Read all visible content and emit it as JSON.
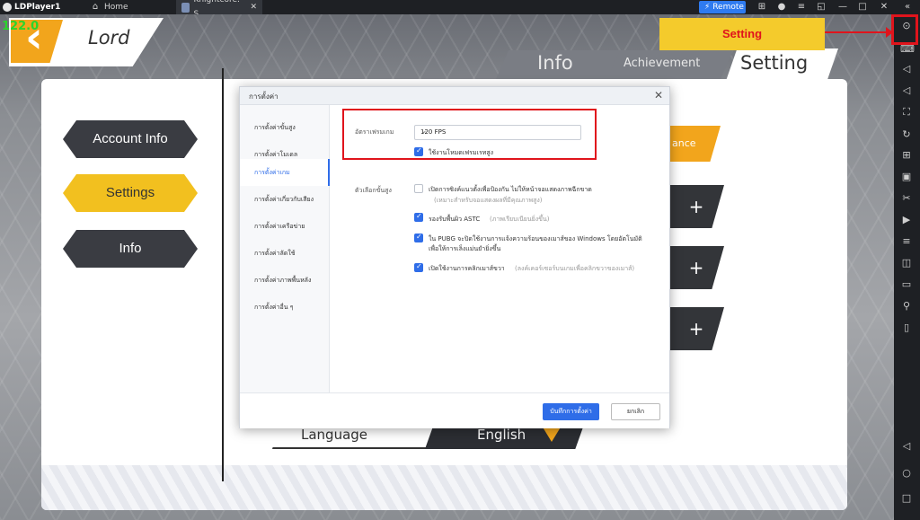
{
  "titlebar": {
    "app_name": "LDPlayer1",
    "tabs": [
      {
        "label": "Home"
      },
      {
        "label": "Knightcore: S..."
      }
    ],
    "remote_label": "Remote"
  },
  "game": {
    "fps_counter": "122.0",
    "back_title": "Lord",
    "tabs": [
      "Info",
      "Achievement",
      "Setting"
    ],
    "menu": [
      "Account Info",
      "Settings",
      "Info"
    ],
    "language_label": "Language",
    "language_value": "English",
    "partial_text": "ance"
  },
  "annotation": {
    "label": "Setting",
    "color": "#f4cb2c"
  },
  "dialog": {
    "title": "การตั้งค่า",
    "sidebar": [
      "การตั้งค่าขั้นสูง",
      "การตั้งค่าโมเดล",
      "การตั้งค่าเกม",
      "การตั้งค่าเกี่ยวกับเสียง",
      "การตั้งค่าเครือข่าย",
      "การตั้งค่าลัดใช้",
      "การตั้งค่าภาพพื้นหลัง",
      "การตั้งค่าอื่น ๆ"
    ],
    "selected_sidebar": "การตั้งค่าเกม",
    "fps_label": "อัตราเฟรมเกม",
    "fps_value": "120 FPS",
    "high_fps_label": "ใช้งานโหมดเฟรมเรทสูง",
    "advanced_label": "ตัวเลือกขั้นสูง",
    "options": [
      {
        "text": "เปิดการซิงค์แนวตั้งเพื่อป้องกัน ไม่ให้หน้าจอแสดงภาพฉีกขาด",
        "sub": "(เหมาะสำหรับจอแสดงผลที่มีคุณภาพสูง)",
        "checked": false
      },
      {
        "text": "รองรับพื้นผิว ASTC",
        "sub": "(ภาพเรียบเนียนยิ่งขึ้น)",
        "checked": true
      },
      {
        "text": "ใน PUBG จะปิดใช้งานการแจ้งความร้อนของเมาส์ของ Windows โดยอัตโนมัติ",
        "line2": "เพื่อให้การเล็งแม่นยำยิ่งขึ้น",
        "checked": true
      },
      {
        "text": "เปิดใช้งานการคลิกเมาส์ขวา",
        "sub": "(ลงค์เคอร์เซอร์บนเกมเพื่อคลิกขวาของเมาส์)",
        "checked": true
      }
    ],
    "save_label": "บันทึกการตั้งค่า",
    "cancel_label": "ยกเลิก"
  }
}
